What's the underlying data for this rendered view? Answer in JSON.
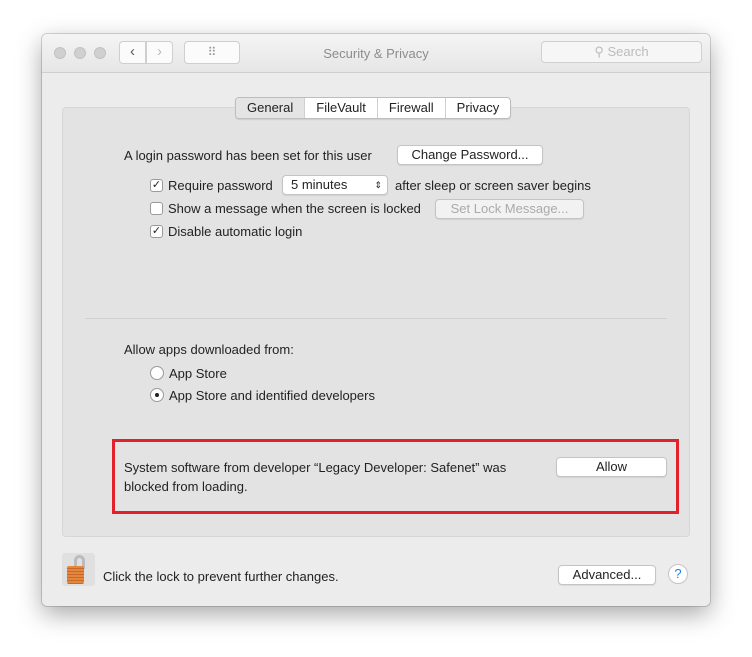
{
  "window": {
    "title": "Security & Privacy",
    "search_placeholder": "Search",
    "back": "‹",
    "forward": "›",
    "grid": "⠿"
  },
  "tabs": [
    "General",
    "FileVault",
    "Firewall",
    "Privacy"
  ],
  "general": {
    "login_text": "A login password has been set for this user",
    "change_password": "Change Password...",
    "require_password": {
      "label": "Require password",
      "checked": true,
      "value": "5 minutes",
      "suffix": "after sleep or screen saver begins"
    },
    "show_message": {
      "label": "Show a message when the screen is locked",
      "checked": false,
      "button": "Set Lock Message..."
    },
    "disable_login": {
      "label": "Disable automatic login",
      "checked": true
    },
    "allow_apps_label": "Allow apps downloaded from:",
    "radio_options": [
      {
        "label": "App Store",
        "selected": false
      },
      {
        "label": "App Store and identified developers",
        "selected": true
      }
    ],
    "blocked_text_1": "System software from developer “Legacy Developer: Safenet” was",
    "blocked_text_2": "blocked from loading.",
    "allow_button": "Allow"
  },
  "footer": {
    "lock_text": "Click the lock to prevent further changes.",
    "advanced": "Advanced...",
    "help": "?"
  },
  "colors": {
    "highlight": "#e3212b",
    "help": "#1a82fb",
    "lock": "#d9782f"
  }
}
